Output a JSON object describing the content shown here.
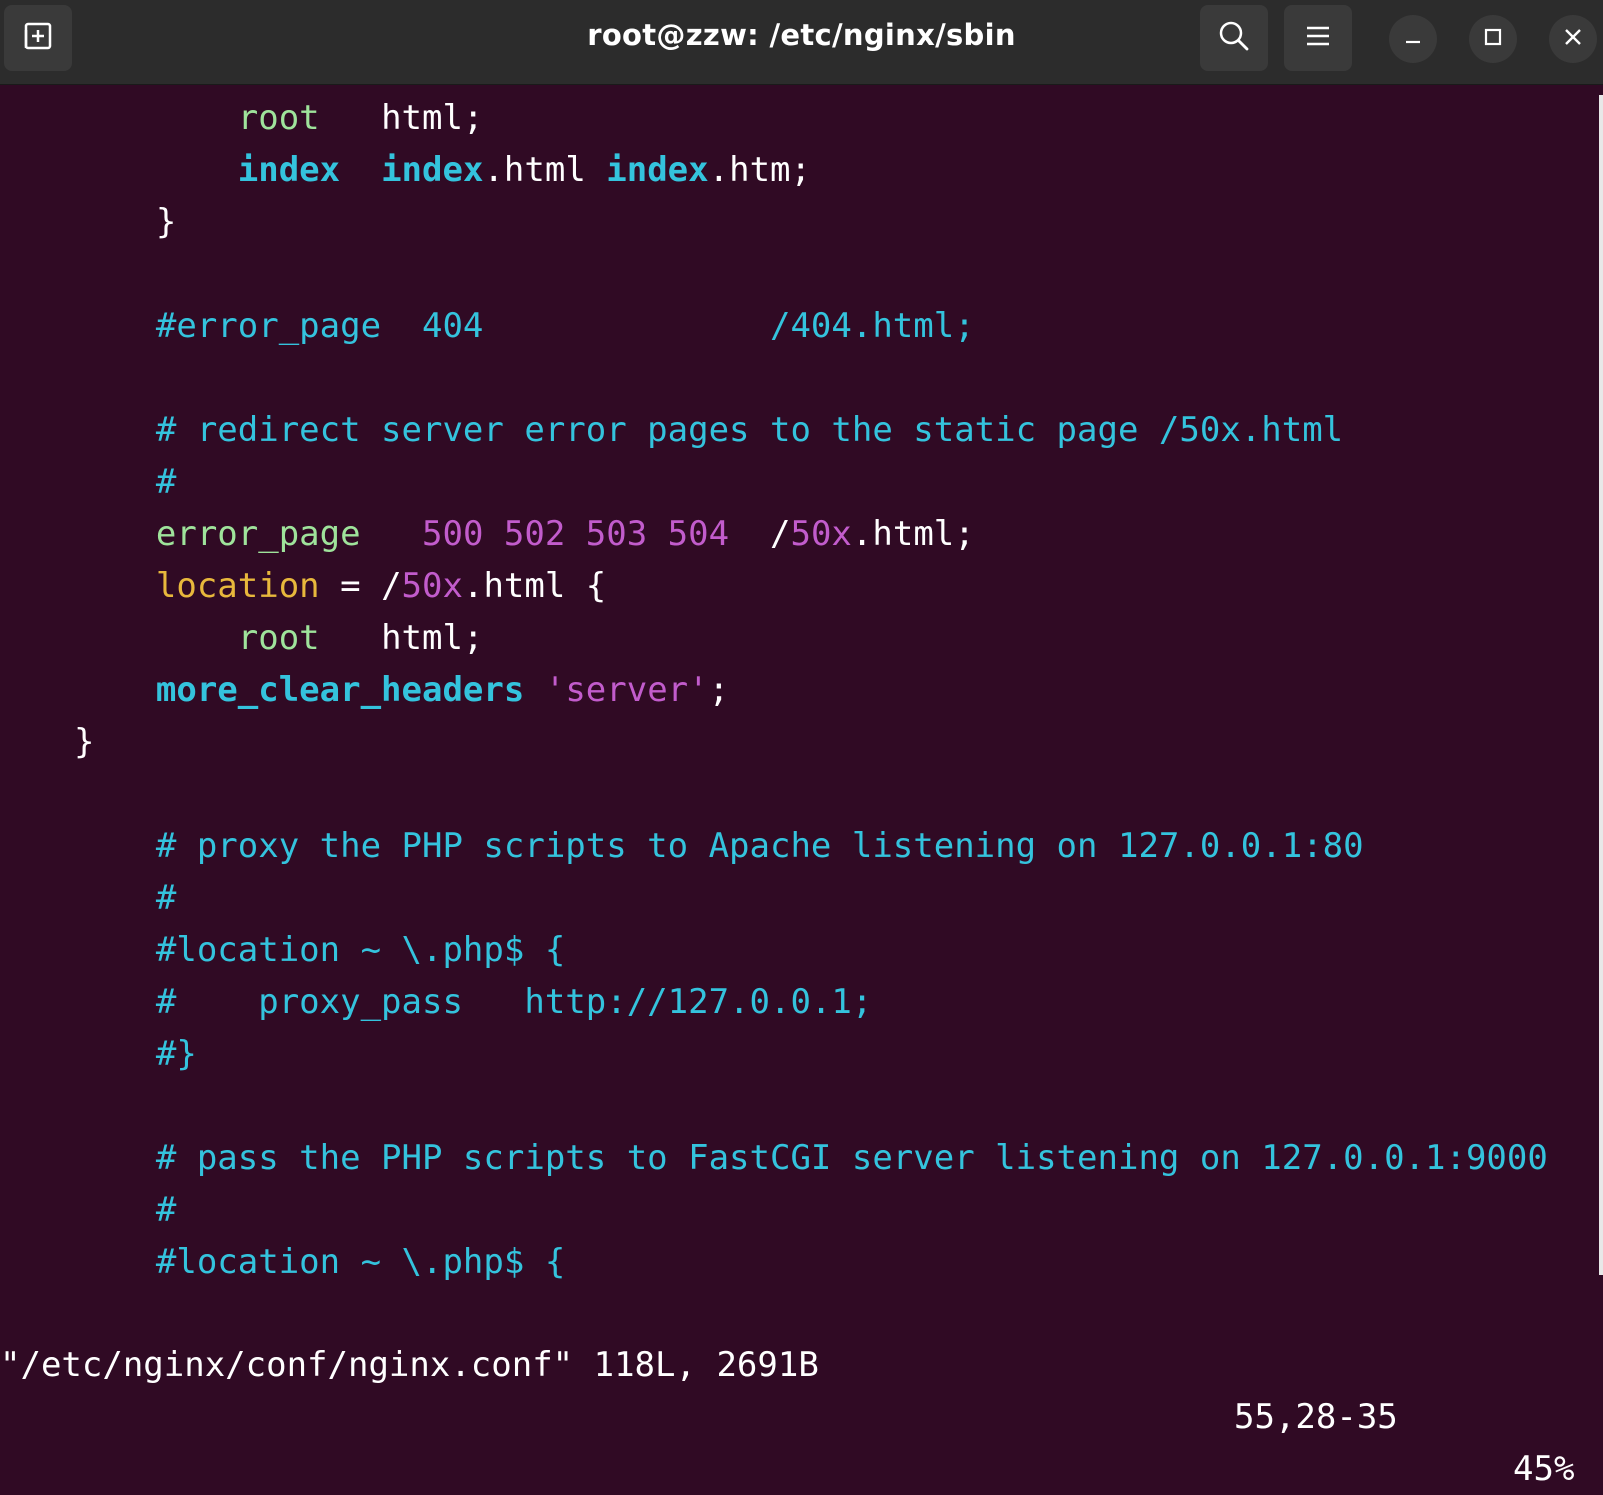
{
  "window": {
    "title": "root@zzw: /etc/nginx/sbin"
  },
  "colors": {
    "background": "#300a24",
    "titlebar": "#2c2c2c",
    "text": "#ffffff",
    "directive_green": "#9fe39b",
    "comment_cyan": "#34c3dd",
    "number_magenta": "#c25ccc",
    "keyword_yellow": "#e8b83c"
  },
  "icons": {
    "new_tab": "new-tab-icon",
    "search": "search-icon",
    "menu": "hamburger-menu-icon",
    "minimize": "minimize-icon",
    "maximize": "maximize-icon",
    "close": "close-icon"
  },
  "editor": {
    "lines": [
      [
        {
          "t": "        ",
          "c": "w"
        },
        {
          "t": "root",
          "c": "g"
        },
        {
          "t": "   html;",
          "c": "w"
        }
      ],
      [
        {
          "t": "        ",
          "c": "w"
        },
        {
          "t": "index",
          "c": "kb"
        },
        {
          "t": "  ",
          "c": "w"
        },
        {
          "t": "index",
          "c": "kb"
        },
        {
          "t": ".html ",
          "c": "w"
        },
        {
          "t": "index",
          "c": "kb"
        },
        {
          "t": ".htm;",
          "c": "w"
        }
      ],
      [
        {
          "t": "    }",
          "c": "w"
        }
      ],
      [],
      [
        {
          "t": "    ",
          "c": "w"
        },
        {
          "t": "#error_page  404              /404.html;",
          "c": "cy"
        }
      ],
      [],
      [
        {
          "t": "    ",
          "c": "w"
        },
        {
          "t": "# redirect server error pages to the static page /50x.html",
          "c": "cy"
        }
      ],
      [
        {
          "t": "    ",
          "c": "w"
        },
        {
          "t": "#",
          "c": "cy"
        }
      ],
      [
        {
          "t": "    ",
          "c": "w"
        },
        {
          "t": "error_page",
          "c": "g"
        },
        {
          "t": "   ",
          "c": "w"
        },
        {
          "t": "500 502 503 504",
          "c": "mg"
        },
        {
          "t": "  /",
          "c": "w"
        },
        {
          "t": "50x",
          "c": "mg"
        },
        {
          "t": ".html;",
          "c": "w"
        }
      ],
      [
        {
          "t": "    ",
          "c": "w"
        },
        {
          "t": "location",
          "c": "yl"
        },
        {
          "t": " = /",
          "c": "w"
        },
        {
          "t": "50x",
          "c": "mg"
        },
        {
          "t": ".html {",
          "c": "w"
        }
      ],
      [
        {
          "t": "        ",
          "c": "w"
        },
        {
          "t": "root",
          "c": "g"
        },
        {
          "t": "   html;",
          "c": "w"
        }
      ],
      [
        {
          "t": "    ",
          "c": "w"
        },
        {
          "t": "more_clear_headers",
          "c": "kb"
        },
        {
          "t": " ",
          "c": "w"
        },
        {
          "t": "'server'",
          "c": "mg"
        },
        {
          "t": ";",
          "c": "w"
        }
      ],
      [
        {
          "t": "}",
          "c": "w"
        }
      ],
      [],
      [
        {
          "t": "    ",
          "c": "w"
        },
        {
          "t": "# proxy the PHP scripts to Apache listening on 127.0.0.1:80",
          "c": "cy"
        }
      ],
      [
        {
          "t": "    ",
          "c": "w"
        },
        {
          "t": "#",
          "c": "cy"
        }
      ],
      [
        {
          "t": "    ",
          "c": "w"
        },
        {
          "t": "#location ~ \\.php$ {",
          "c": "cy"
        }
      ],
      [
        {
          "t": "    ",
          "c": "w"
        },
        {
          "t": "#    proxy_pass   http://127.0.0.1;",
          "c": "cy"
        }
      ],
      [
        {
          "t": "    ",
          "c": "w"
        },
        {
          "t": "#}",
          "c": "cy"
        }
      ],
      [],
      [
        {
          "t": "    ",
          "c": "w"
        },
        {
          "t": "# pass the PHP scripts to FastCGI server listening on 127.0.0.1:9000",
          "c": "cy"
        }
      ],
      [
        {
          "t": "    ",
          "c": "w"
        },
        {
          "t": "#",
          "c": "cy"
        }
      ],
      [
        {
          "t": "    ",
          "c": "w"
        },
        {
          "t": "#location ~ \\.php$ {",
          "c": "cy"
        }
      ]
    ]
  },
  "statusline": {
    "file_info": "\"/etc/nginx/conf/nginx.conf\" 118L, 2691B",
    "cursor_position": "55,28-35",
    "scroll_percent": "45%"
  }
}
